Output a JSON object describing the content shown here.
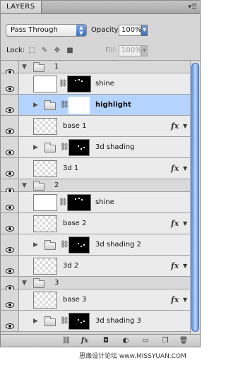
{
  "panel": {
    "tab_label": "LAYERS",
    "menu_icon": "panel-menu-icon",
    "blend_mode": "Pass Through",
    "opacity_label": "Opacity:",
    "opacity_value": "100%",
    "lock_label": "Lock:",
    "fill_label": "Fill:",
    "fill_value": "100%"
  },
  "layers": [
    {
      "kind": "group",
      "name": "1",
      "expanded": true,
      "indent": 0
    },
    {
      "kind": "layer",
      "name": "shine",
      "thumb": "white",
      "mask": true,
      "indent": 1
    },
    {
      "kind": "group",
      "name": "highlight",
      "expanded": false,
      "indent": 1,
      "mask": true,
      "mask_style": "white",
      "selected": true,
      "bold": true
    },
    {
      "kind": "layer",
      "name": "base 1",
      "thumb": "checker",
      "fx": true,
      "indent": 1
    },
    {
      "kind": "group",
      "name": "3d shading",
      "expanded": false,
      "indent": 1,
      "mask": true
    },
    {
      "kind": "layer",
      "name": "3d 1",
      "thumb": "checker",
      "fx": true,
      "indent": 1
    },
    {
      "kind": "group",
      "name": "2",
      "expanded": true,
      "indent": 0
    },
    {
      "kind": "layer",
      "name": "shine",
      "thumb": "white",
      "mask": true,
      "indent": 1
    },
    {
      "kind": "layer",
      "name": "base 2",
      "thumb": "checker",
      "fx": true,
      "indent": 1
    },
    {
      "kind": "group",
      "name": "3d shading 2",
      "expanded": false,
      "indent": 1,
      "mask": true
    },
    {
      "kind": "layer",
      "name": "3d 2",
      "thumb": "checker",
      "fx": true,
      "indent": 1
    },
    {
      "kind": "group",
      "name": "3",
      "expanded": true,
      "indent": 0
    },
    {
      "kind": "layer",
      "name": "base 3",
      "thumb": "checker",
      "fx": true,
      "indent": 1
    },
    {
      "kind": "group",
      "name": "3d shading 3",
      "expanded": false,
      "indent": 1,
      "mask": true
    }
  ],
  "fx_label": "fx",
  "bottom_icons": [
    "link-layers-icon",
    "fx-icon",
    "add-mask-icon",
    "adjustment-layer-icon",
    "new-group-icon",
    "new-layer-icon",
    "trash-icon"
  ],
  "watermark": "思缘设计论坛 www.MISSYUAN.COM"
}
